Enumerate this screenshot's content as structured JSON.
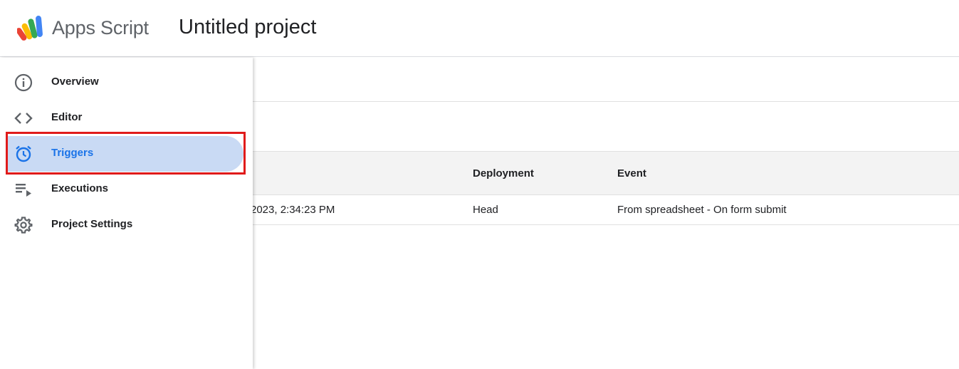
{
  "header": {
    "app_name": "Apps Script",
    "project_title": "Untitled project"
  },
  "sidebar": {
    "items": [
      {
        "label": "Overview",
        "icon": "info-icon",
        "active": false
      },
      {
        "label": "Editor",
        "icon": "code-icon",
        "active": false
      },
      {
        "label": "Triggers",
        "icon": "alarm-clock-icon",
        "active": true
      },
      {
        "label": "Executions",
        "icon": "executions-list-icon",
        "active": false
      },
      {
        "label": "Project Settings",
        "icon": "gear-icon",
        "active": false
      }
    ]
  },
  "table": {
    "headers": {
      "deployment": "Deployment",
      "event": "Event"
    },
    "rows": [
      {
        "last_run": "2023, 2:34:23 PM",
        "deployment": "Head",
        "event": "From spreadsheet - On form submit"
      }
    ]
  },
  "colors": {
    "active_bg": "#c9daf4",
    "active_text": "#1a73e8",
    "highlight_border": "#e01b1b",
    "icon_gray": "#5f6368"
  }
}
